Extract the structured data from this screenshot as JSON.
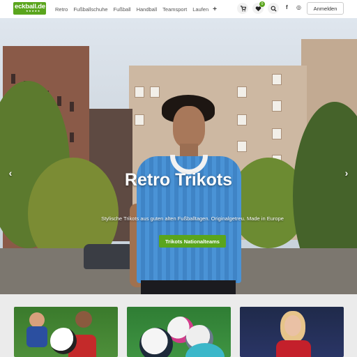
{
  "header": {
    "logo_text": "eckball.de",
    "logo_dots": "★★★★★",
    "nav_items": [
      "Retro",
      "Fußballschuhe",
      "Fußball",
      "Handball",
      "Teamsport",
      "Laufen"
    ],
    "nav_more": "+",
    "cart_icon": "cart-icon",
    "wishlist_icon": "heart-icon",
    "wishlist_count": "0",
    "search_icon": "search-icon",
    "social": {
      "facebook": "f",
      "instagram": "◎"
    },
    "login_label": "Anmelden"
  },
  "hero": {
    "title": "Retro Trikots",
    "subtitle": "Stylische Trikots aus guten alten Fußballtagen. Originalgetreu. Made in Europe",
    "cta_label": "Trikots Nationalteams",
    "prev_arrow": "‹",
    "next_arrow": "›",
    "slides": 3,
    "active_slide": 1
  },
  "colors": {
    "brand_green": "#5aa51d"
  }
}
